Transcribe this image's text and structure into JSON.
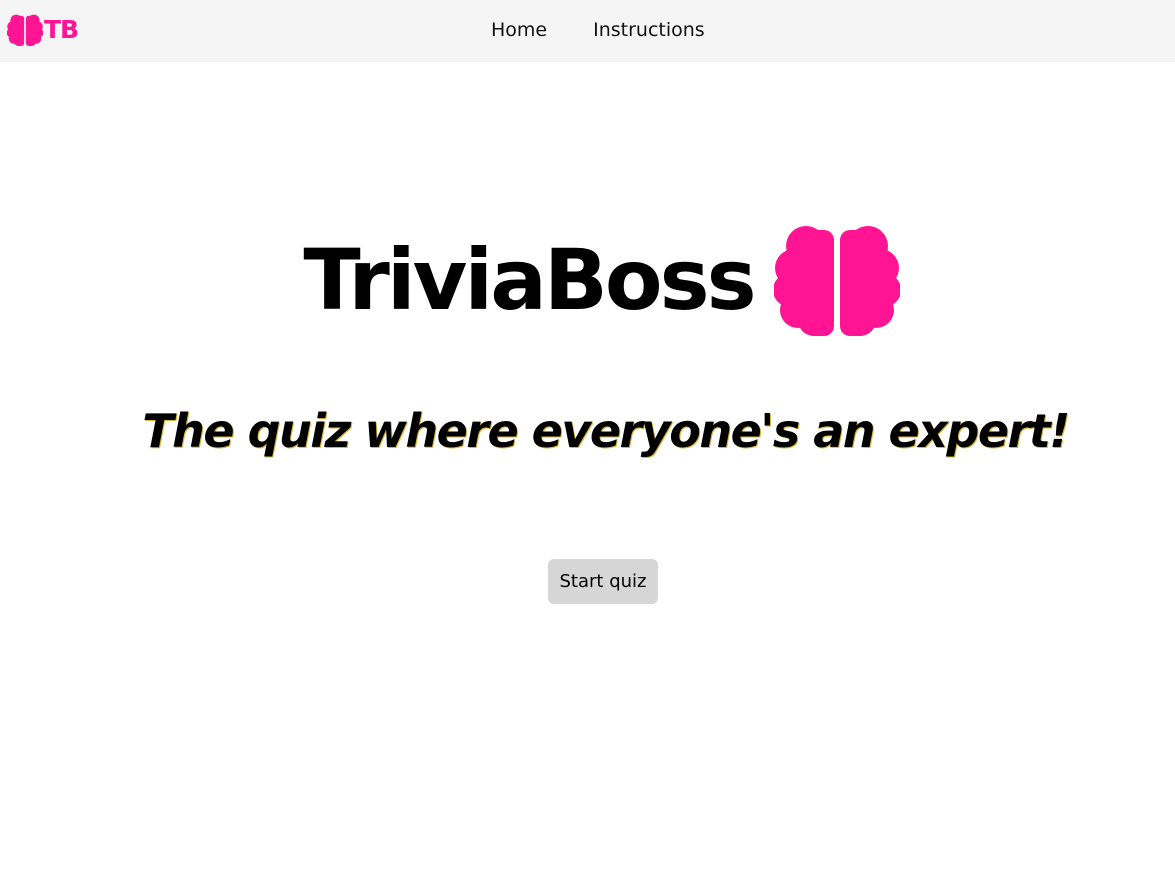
{
  "nav": {
    "logo_text": "TB",
    "logo_icon": "brain-icon",
    "links": [
      "Home",
      "Instructions"
    ]
  },
  "hero": {
    "title": "TriviaBoss",
    "icon": "brain-icon",
    "tagline": "The quiz where everyone's an expert!"
  },
  "actions": {
    "start_label": "Start quiz"
  },
  "colors": {
    "brand_pink": "#ff1493",
    "nav_background": "#f5f5f5",
    "button_background": "#d6d6d6"
  }
}
